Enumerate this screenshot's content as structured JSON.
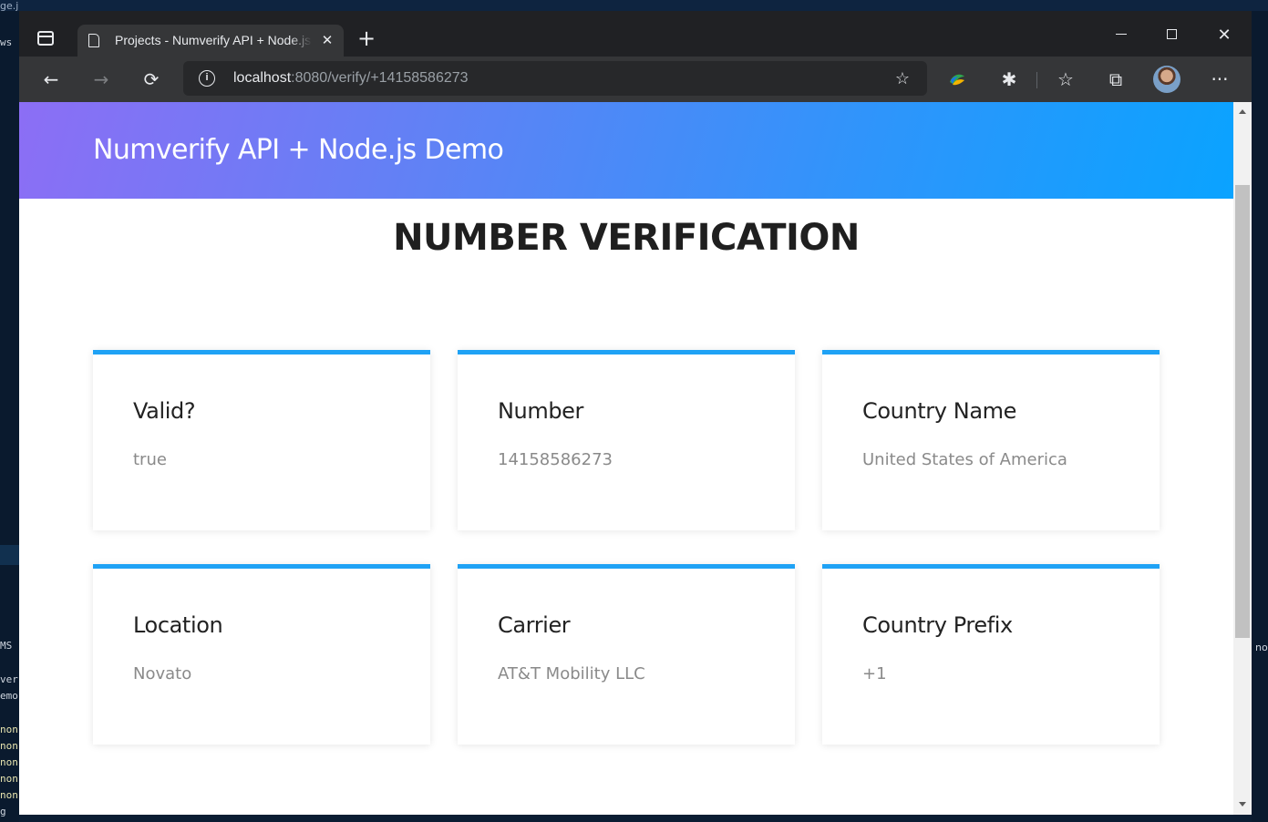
{
  "background": {
    "top_fragments": [
      "ge.j"
    ],
    "left_fragments": [
      "ws",
      "MS",
      "ver:",
      "emo",
      "non",
      "non",
      "non",
      "non",
      "non",
      "g"
    ],
    "right_fragment": "no"
  },
  "browser": {
    "tab": {
      "title": "Projects - Numverify API + Node.js Demo",
      "close_glyph": "✕"
    },
    "new_tab_glyph": "+",
    "window_controls": {
      "close_glyph": "✕"
    },
    "toolbar": {
      "back_glyph": "←",
      "forward_glyph": "→",
      "refresh_glyph": "⟳",
      "address": {
        "host": "localhost",
        "rest": ":8080/verify/+14158586273"
      },
      "favorite_glyph": "☆",
      "extensions_glyph": "✱",
      "favorites_glyph": "☆",
      "collections_glyph": "⧉",
      "more_glyph": "···"
    }
  },
  "page": {
    "brand": "Numverify API + Node.js Demo",
    "heading": "NUMBER VERIFICATION",
    "cards": [
      {
        "label": "Valid?",
        "value": "true"
      },
      {
        "label": "Number",
        "value": "14158586273"
      },
      {
        "label": "Country Name",
        "value": "United States of America"
      },
      {
        "label": "Location",
        "value": "Novato"
      },
      {
        "label": "Carrier",
        "value": "AT&T Mobility LLC"
      },
      {
        "label": "Country Prefix",
        "value": "+1"
      }
    ]
  },
  "colors": {
    "accent": "#1fa2f5",
    "hero_gradient_start": "#8c6ef5",
    "hero_gradient_end": "#0aa3ff"
  }
}
